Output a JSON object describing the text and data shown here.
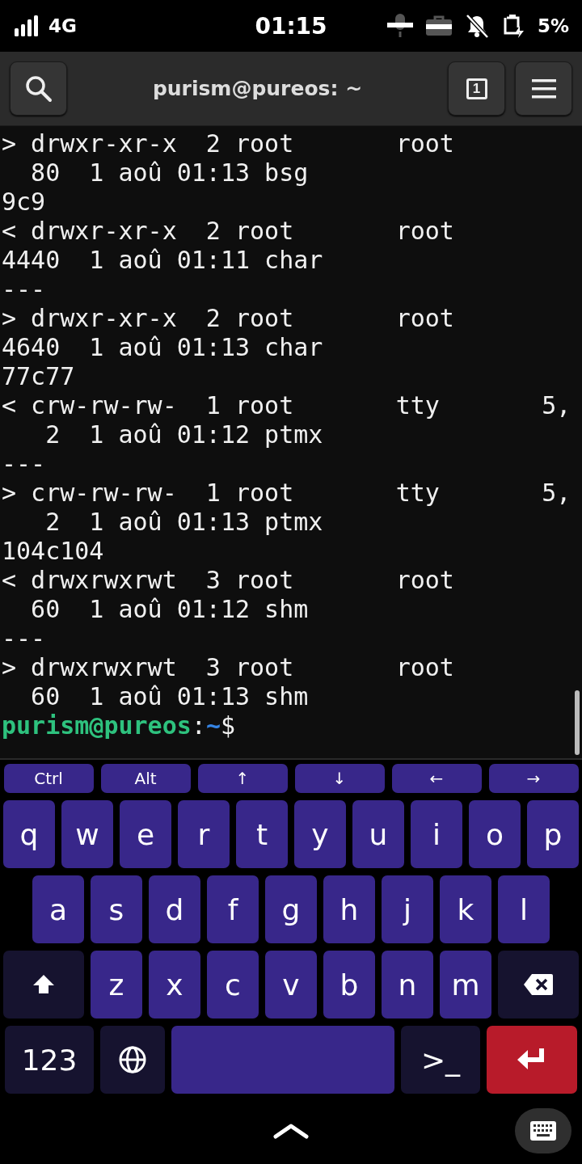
{
  "status_bar": {
    "network": "4G",
    "time": "01:15",
    "battery": "5%"
  },
  "header": {
    "title": "purism@pureos: ~",
    "tab_count": "1"
  },
  "terminal": {
    "lines": [
      "> drwxr-xr-x  2 root       root",
      "  80  1 aoû 01:13 bsg",
      "9c9",
      "< drwxr-xr-x  2 root       root",
      "4440  1 aoû 01:11 char",
      "---",
      "> drwxr-xr-x  2 root       root",
      "4640  1 aoû 01:13 char",
      "77c77",
      "< crw-rw-rw-  1 root       tty       5,",
      "   2  1 aoû 01:12 ptmx",
      "---",
      "> crw-rw-rw-  1 root       tty       5,",
      "   2  1 aoû 01:13 ptmx",
      "104c104",
      "< drwxrwxrwt  3 root       root",
      "  60  1 aoû 01:12 shm",
      "---",
      "> drwxrwxrwt  3 root       root",
      "  60  1 aoû 01:13 shm"
    ],
    "prompt": {
      "user_host": "purism@pureos",
      "separator": ":",
      "path": "~",
      "symbol": "$"
    }
  },
  "keyboard": {
    "extra_keys": [
      "Ctrl",
      "Alt",
      "↑",
      "↓",
      "←",
      "→"
    ],
    "rows": [
      [
        {
          "kind": "letter",
          "label": "q"
        },
        {
          "kind": "letter",
          "label": "w"
        },
        {
          "kind": "letter",
          "label": "e"
        },
        {
          "kind": "letter",
          "label": "r"
        },
        {
          "kind": "letter",
          "label": "t"
        },
        {
          "kind": "letter",
          "label": "y"
        },
        {
          "kind": "letter",
          "label": "u"
        },
        {
          "kind": "letter",
          "label": "i"
        },
        {
          "kind": "letter",
          "label": "o"
        },
        {
          "kind": "letter",
          "label": "p"
        }
      ],
      [
        {
          "kind": "letter",
          "label": "a"
        },
        {
          "kind": "letter",
          "label": "s"
        },
        {
          "kind": "letter",
          "label": "d"
        },
        {
          "kind": "letter",
          "label": "f"
        },
        {
          "kind": "letter",
          "label": "g"
        },
        {
          "kind": "letter",
          "label": "h"
        },
        {
          "kind": "letter",
          "label": "j"
        },
        {
          "kind": "letter",
          "label": "k"
        },
        {
          "kind": "letter",
          "label": "l"
        }
      ],
      [
        {
          "kind": "shift"
        },
        {
          "kind": "letter",
          "label": "z"
        },
        {
          "kind": "letter",
          "label": "x"
        },
        {
          "kind": "letter",
          "label": "c"
        },
        {
          "kind": "letter",
          "label": "v"
        },
        {
          "kind": "letter",
          "label": "b"
        },
        {
          "kind": "letter",
          "label": "n"
        },
        {
          "kind": "letter",
          "label": "m"
        },
        {
          "kind": "backspace"
        }
      ],
      [
        {
          "kind": "mode",
          "label": "123"
        },
        {
          "kind": "globe"
        },
        {
          "kind": "space"
        },
        {
          "kind": "terminal",
          "label": ">_"
        },
        {
          "kind": "enter"
        }
      ]
    ]
  }
}
